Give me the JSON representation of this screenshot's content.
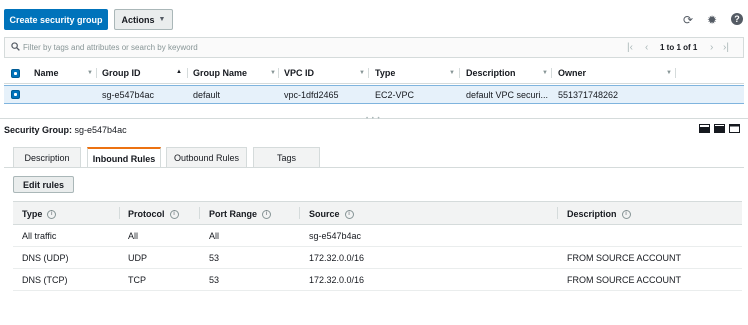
{
  "toolbar": {
    "create_label": "Create security group",
    "actions_label": "Actions",
    "icons": [
      "refresh-icon",
      "gear-icon",
      "help-icon"
    ]
  },
  "filter": {
    "placeholder": "Filter by tags and attributes or search by keyword",
    "pagination": "1 to 1 of 1"
  },
  "sg_table": {
    "headers": [
      "Name",
      "Group ID",
      "Group Name",
      "VPC ID",
      "Type",
      "Description",
      "Owner"
    ],
    "rows": [
      {
        "name": "",
        "group_id": "sg-e547b4ac",
        "group_name": "default",
        "vpc_id": "vpc-1dfd2465",
        "type": "EC2-VPC",
        "description": "default VPC securi...",
        "owner": "551371748262"
      }
    ]
  },
  "detail": {
    "label": "Security Group:",
    "group_id": "sg-e547b4ac"
  },
  "tabs": [
    {
      "label": "Description",
      "active": false
    },
    {
      "label": "Inbound Rules",
      "active": true
    },
    {
      "label": "Outbound Rules",
      "active": false
    },
    {
      "label": "Tags",
      "active": false
    }
  ],
  "edit_rules_label": "Edit rules",
  "rules": {
    "headers": [
      "Type",
      "Protocol",
      "Port Range",
      "Source",
      "Description"
    ],
    "rows": [
      {
        "type": "All traffic",
        "protocol": "All",
        "port_range": "All",
        "source": "sg-e547b4ac",
        "description": ""
      },
      {
        "type": "DNS (UDP)",
        "protocol": "UDP",
        "port_range": "53",
        "source": "172.32.0.0/16",
        "description": "FROM SOURCE ACCOUNT"
      },
      {
        "type": "DNS (TCP)",
        "protocol": "TCP",
        "port_range": "53",
        "source": "172.32.0.0/16",
        "description": "FROM SOURCE ACCOUNT"
      }
    ]
  },
  "colors": {
    "primary": "#0073bb",
    "active_tab_accent": "#ec7211",
    "selected_row": "#e6f1fa"
  }
}
